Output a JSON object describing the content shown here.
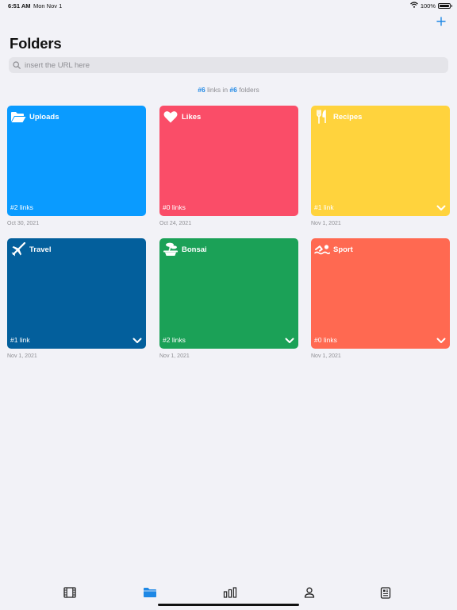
{
  "status_bar": {
    "time": "6:51 AM",
    "date": "Mon Nov 1",
    "battery": "100%",
    "icons": [
      "wifi-icon",
      "battery-icon"
    ]
  },
  "header": {
    "title": "Folders",
    "add_icon": "plus-icon"
  },
  "search": {
    "placeholder": "insert the URL here",
    "value": "",
    "icon": "search-icon"
  },
  "summary": {
    "links_count": "#6",
    "links_word": " links in ",
    "folders_count": "#6",
    "folders_word": " folders"
  },
  "folders": [
    {
      "title": "Uploads",
      "count": "#2 links",
      "date": "Oct 30, 2021",
      "icon": "folder-open-icon",
      "color": "#0a9bff",
      "has_chevron": false
    },
    {
      "title": "Likes",
      "count": "#0 links",
      "date": "Oct 24, 2021",
      "icon": "heart-icon",
      "color": "#fa4d68",
      "has_chevron": false
    },
    {
      "title": "Recipes",
      "count": "#1 link",
      "date": "Nov 1, 2021",
      "icon": "fork-knife-icon",
      "color": "#ffd33d",
      "has_chevron": true
    },
    {
      "title": "Travel",
      "count": "#1 link",
      "date": "Nov 1, 2021",
      "icon": "airplane-icon",
      "color": "#035f9c",
      "has_chevron": true
    },
    {
      "title": "Bonsai",
      "count": "#2 links",
      "date": "Nov 1, 2021",
      "icon": "bonsai-icon",
      "color": "#1ba157",
      "has_chevron": true
    },
    {
      "title": "Sport",
      "count": "#0 links",
      "date": "Nov 1, 2021",
      "icon": "swimmer-icon",
      "color": "#ff6951",
      "has_chevron": true
    }
  ],
  "tab_bar": {
    "items": [
      {
        "icon": "film-icon",
        "active": false
      },
      {
        "icon": "folder-icon",
        "active": true
      },
      {
        "icon": "bar-chart-icon",
        "active": false
      },
      {
        "icon": "person-icon",
        "active": false
      },
      {
        "icon": "document-icon",
        "active": false
      }
    ],
    "active_color": "#1e88e5",
    "inactive_color": "#222222"
  }
}
